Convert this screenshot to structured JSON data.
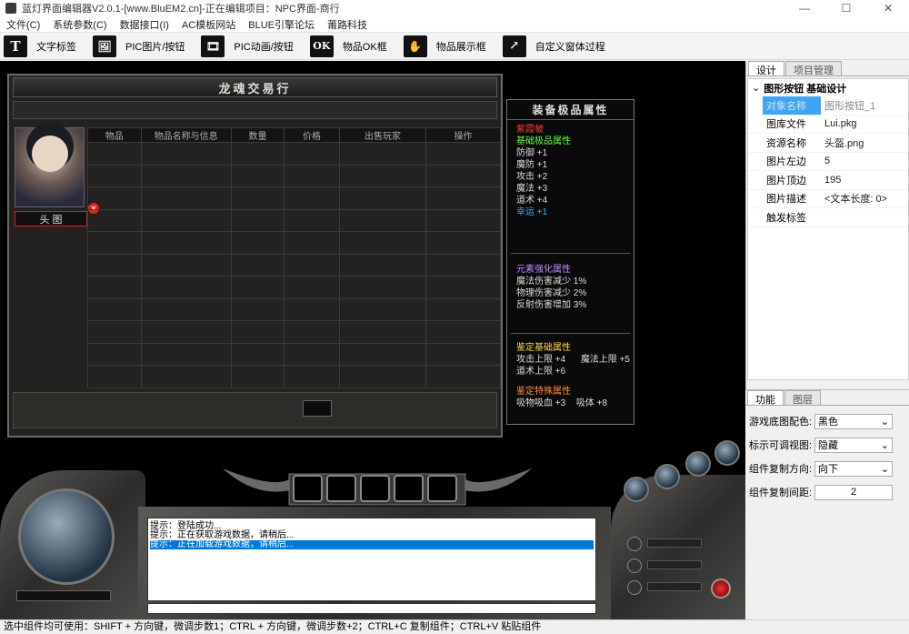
{
  "window": {
    "title": "蓝灯界面编辑器V2.0.1-[www.BluEM2.cn]-正在编辑项目：NPC界面-商行"
  },
  "menu": [
    "文件(C)",
    "系统参数(C)",
    "数据接口(I)",
    "AC模板网站",
    "BLUE引擎论坛",
    "莆路科技"
  ],
  "toolbar": [
    {
      "icon": "T",
      "label": "文字标签"
    },
    {
      "icon": "🖼",
      "label": "PIC图片/按钮"
    },
    {
      "icon": "🎞",
      "label": "PIC动画/按钮"
    },
    {
      "icon": "OK",
      "label": "物品OK框"
    },
    {
      "icon": "✋",
      "label": "物品展示框"
    },
    {
      "icon": "↗",
      "label": "自定义窗体过程"
    }
  ],
  "game": {
    "title": "龙魂交易行",
    "avatar_label": "头 图",
    "columns": [
      "物品",
      "物品名称与信息",
      "数量",
      "价格",
      "出售玩家",
      "操作"
    ],
    "equip_panel": {
      "title": "装备极品属性",
      "name": "紫霞帔",
      "basic_header": "基础极品属性",
      "basic": [
        "防御 +1",
        "魔防 +1",
        "攻击 +2",
        "魔法 +3",
        "道术 +4",
        "幸运 +1"
      ],
      "elem_header": "元素强化属性",
      "elem": [
        "魔法伤害减少 1%",
        "物理伤害减少 2%",
        "反射伤害增加 3%"
      ],
      "appraise_header": "鉴定基础属性",
      "appraise": [
        "攻击上限 +4",
        "魔法上限 +5",
        "道术上限 +6"
      ],
      "special_header": "鉴定特殊属性",
      "special": [
        "吸物吸血 +3",
        "吸体 +8"
      ]
    },
    "chat": [
      "提示：登陆成功...",
      "提示：正在获取游戏数据，请稍后...",
      "提示：正在加载游戏数据，请稍后..."
    ]
  },
  "right_panel": {
    "tabs": [
      "设计",
      "项目管理"
    ],
    "category": "图形按钮 基础设计",
    "props": [
      {
        "k": "对象名称",
        "v": "图形按钮_1"
      },
      {
        "k": "图库文件",
        "v": "Lui.pkg"
      },
      {
        "k": "资源名称",
        "v": "头盔.png"
      },
      {
        "k": "图片左边",
        "v": "5"
      },
      {
        "k": "图片顶边",
        "v": "195"
      },
      {
        "k": "图片描述",
        "v": "<文本长度: 0>"
      },
      {
        "k": "触发标签",
        "v": ""
      }
    ],
    "func_tabs": [
      "功能",
      "图层"
    ],
    "func": [
      {
        "k": "游戏底图配色:",
        "v": "黑色"
      },
      {
        "k": "标示可调视图:",
        "v": "隐藏"
      },
      {
        "k": "组件复制方向:",
        "v": "向下"
      },
      {
        "k": "组件复制间距:",
        "v": "2"
      }
    ]
  },
  "status": "选中组件均可使用：SHIFT + 方向键，微调步数1；CTRL + 方向键，微调步数+2；CTRL+C 复制组件；CTRL+V 粘贴组件"
}
